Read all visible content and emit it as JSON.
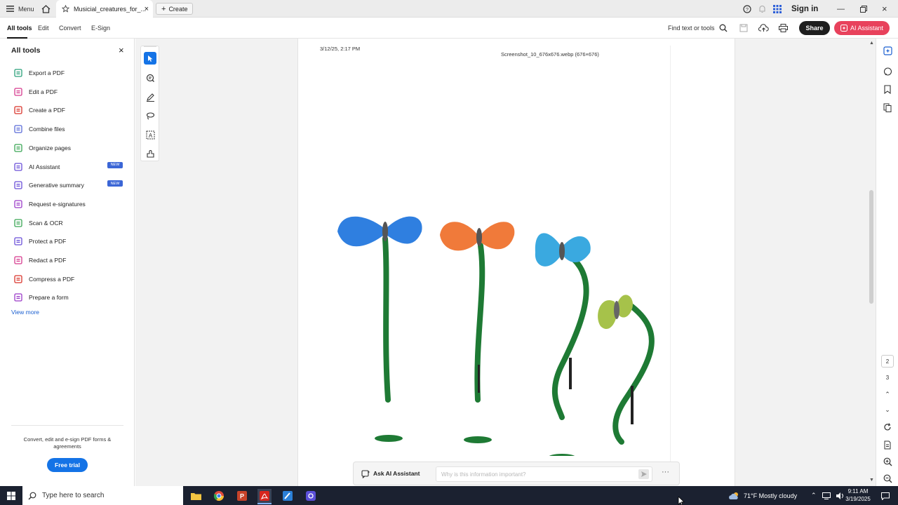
{
  "titlebar": {
    "menu_label": "Menu",
    "tab_title": "Musicial_creatures_for_...",
    "create_label": "Create",
    "sign_in": "Sign in"
  },
  "toolbar": {
    "tabs": [
      "All tools",
      "Edit",
      "Convert",
      "E-Sign"
    ],
    "find_label": "Find text or tools",
    "share_label": "Share",
    "ai_label": "AI Assistant"
  },
  "left_panel": {
    "title": "All tools",
    "items": [
      {
        "label": "Export a PDF",
        "icon": "export-pdf-icon",
        "color": "#2aa07a"
      },
      {
        "label": "Edit a PDF",
        "icon": "edit-pdf-icon",
        "color": "#d63a8e"
      },
      {
        "label": "Create a PDF",
        "icon": "create-pdf-icon",
        "color": "#d9342b"
      },
      {
        "label": "Combine files",
        "icon": "combine-files-icon",
        "color": "#5b6cd8"
      },
      {
        "label": "Organize pages",
        "icon": "organize-pages-icon",
        "color": "#3aa655"
      },
      {
        "label": "AI Assistant",
        "icon": "ai-assistant-icon",
        "color": "#6a4fd8",
        "badge": "NEW"
      },
      {
        "label": "Generative summary",
        "icon": "generative-summary-icon",
        "color": "#6a4fd8",
        "badge": "NEW"
      },
      {
        "label": "Request e-signatures",
        "icon": "request-esignatures-icon",
        "color": "#9b3bc8"
      },
      {
        "label": "Scan & OCR",
        "icon": "scan-ocr-icon",
        "color": "#3aa655"
      },
      {
        "label": "Protect a PDF",
        "icon": "protect-pdf-icon",
        "color": "#6a4fd8"
      },
      {
        "label": "Redact a PDF",
        "icon": "redact-pdf-icon",
        "color": "#d63a8e"
      },
      {
        "label": "Compress a PDF",
        "icon": "compress-pdf-icon",
        "color": "#d9342b"
      },
      {
        "label": "Prepare a form",
        "icon": "prepare-form-icon",
        "color": "#9b3bc8"
      }
    ],
    "view_more": "View more",
    "promo_text": "Convert, edit and e-sign PDF forms & agreements",
    "free_trial": "Free trial"
  },
  "document": {
    "timestamp": "3/12/25, 2:17 PM",
    "header_text": "Screenshot_10_676x676.webp (676×676)",
    "butterflies": [
      {
        "wing": "#2f7fe0",
        "name": "blue"
      },
      {
        "wing": "#f07a3a",
        "name": "orange"
      },
      {
        "wing": "#3aa9e0",
        "name": "light-blue"
      },
      {
        "wing": "#a6c24a",
        "name": "lime"
      }
    ]
  },
  "ask_bar": {
    "label": "Ask AI Assistant",
    "placeholder": "Why is this information important?"
  },
  "right_rail": {
    "page_numbers": [
      "2",
      "3"
    ]
  },
  "taskbar": {
    "search_placeholder": "Type here to search",
    "weather": "71°F  Mostly cloudy",
    "time": "9:11 AM",
    "date": "3/19/2025"
  }
}
